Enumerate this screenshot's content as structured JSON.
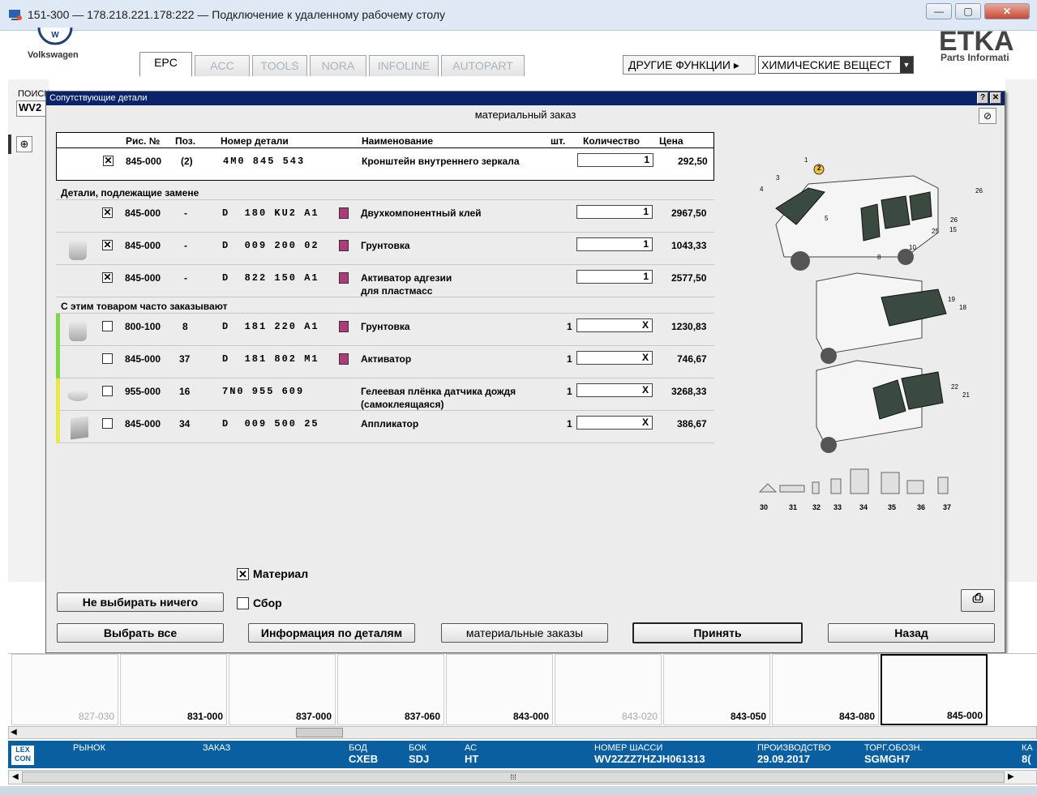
{
  "window": {
    "title": "151-300 — 178.218.221.178:222 — Подключение к удаленному рабочему столу"
  },
  "app": {
    "brand": "Volkswagen",
    "etka_logo": "ETKA",
    "etka_sub": "Parts Informati",
    "tabs": [
      {
        "label": "EPC",
        "active": true
      },
      {
        "label": "ACC"
      },
      {
        "label": "TOOLS"
      },
      {
        "label": "NORA"
      },
      {
        "label": "INFOLINE"
      },
      {
        "label": "AUTOPART"
      }
    ],
    "other_functions": "ДРУГИЕ ФУНКЦИИ ▸",
    "chem_select": "ХИМИЧЕСКИЕ ВЕЩЕСТ",
    "search_label": "ПОИСК",
    "search_value": "WV2"
  },
  "dialog": {
    "title": "Сопутствующие детали",
    "help": "?",
    "close": "✕",
    "subtitle": "материальный заказ",
    "columns": {
      "fig": "Рис. №",
      "pos": "Поз.",
      "part": "Номер детали",
      "name": "Наименование",
      "pcs": "шт.",
      "qty": "Количество",
      "price": "Цена"
    },
    "main_row": {
      "checked": "✕",
      "fig": "845-000",
      "pos": "(2)",
      "part": "4M0 845 543",
      "name": "Кронштейн внутреннего зеркала",
      "qty": "1",
      "price": "292,50"
    },
    "section_replace": "Детали, подлежащие замене",
    "replace_rows": [
      {
        "checked": "✕",
        "fig": "845-000",
        "pos": "-",
        "part": "D  180 KU2 A1",
        "name": "Двухкомпонентный клей",
        "name2": "",
        "qty": "1",
        "price": "2967,50"
      },
      {
        "checked": "✕",
        "fig": "845-000",
        "pos": "-",
        "part": "D  009 200 02",
        "name": "Грунтовка",
        "name2": "",
        "qty": "1",
        "price": "1043,33"
      },
      {
        "checked": "✕",
        "fig": "845-000",
        "pos": "-",
        "part": "D  822 150 A1",
        "name": "Активатор адгезии",
        "name2": "для пластмасс",
        "qty": "1",
        "price": "2577,50"
      }
    ],
    "section_often": "С этим товаром часто заказывают",
    "often_rows": [
      {
        "checked": "",
        "fig": "800-100",
        "pos": "8",
        "part": "D  181 220 A1",
        "name": "Грунтовка",
        "name2": "",
        "pcs": "1",
        "qty": "X",
        "price": "1230,83",
        "bar": "#7fd94a"
      },
      {
        "checked": "",
        "fig": "845-000",
        "pos": "37",
        "part": "D  181 802 M1",
        "name": "Активатор",
        "name2": "",
        "pcs": "1",
        "qty": "X",
        "price": "746,67",
        "bar": "#7fd94a"
      },
      {
        "checked": "",
        "fig": "955-000",
        "pos": "16",
        "part": "7N0 955 609",
        "name": "Гелеевая плёнка датчика дождя",
        "name2": "(самоклеящаяся)",
        "pcs": "1",
        "qty": "X",
        "price": "3268,33",
        "bar": "#e8e84a"
      },
      {
        "checked": "",
        "fig": "845-000",
        "pos": "34",
        "part": "D  009 500 25",
        "name": "Аппликатор",
        "name2": "",
        "pcs": "1",
        "qty": "X",
        "price": "386,67",
        "bar": "#e8e84a"
      }
    ],
    "image_labels": [
      "30",
      "31",
      "32",
      "33",
      "34",
      "35",
      "36",
      "37"
    ],
    "callouts": [
      "1",
      "2",
      "3",
      "4",
      "26",
      "5",
      "25",
      "15",
      "26",
      "10",
      "8",
      "19",
      "18",
      "22",
      "21"
    ],
    "material_label": "Материал",
    "material_checked": "✕",
    "assembly_label": "Сбор",
    "btn_select_none": "Не выбирать ничего",
    "btn_select_all": "Выбрать все",
    "btn_part_info": "Информация по деталям",
    "btn_material_orders": "материальные заказы",
    "btn_accept": "Принять",
    "btn_back": "Назад"
  },
  "thumbnails": [
    {
      "label": "827-030",
      "dim": true
    },
    {
      "label": "831-000"
    },
    {
      "label": "837-000"
    },
    {
      "label": "837-060"
    },
    {
      "label": "843-000"
    },
    {
      "label": "843-020",
      "dim": true
    },
    {
      "label": "843-050"
    },
    {
      "label": "843-080"
    },
    {
      "label": "845-000",
      "selected": true
    }
  ],
  "status": {
    "market_label": "РЫНОК",
    "order_label": "ЗАКАЗ",
    "bod_label": "БОД",
    "bod": "CXEB",
    "bok_label": "БОК",
    "bok": "SDJ",
    "ac_label": "АС",
    "ac": "HT",
    "chassis_label": "НОМЕР ШАССИ",
    "chassis": "WV2ZZZ7HZJH061313",
    "prod_label": "ПРОИЗВОДСТВО",
    "prod": "29.09.2017",
    "trade_label": "ТОРГ.ОБОЗН.",
    "trade": "SGMGH7",
    "ka_label": "КА",
    "ka": "8(",
    "logo": "LEX CON"
  }
}
